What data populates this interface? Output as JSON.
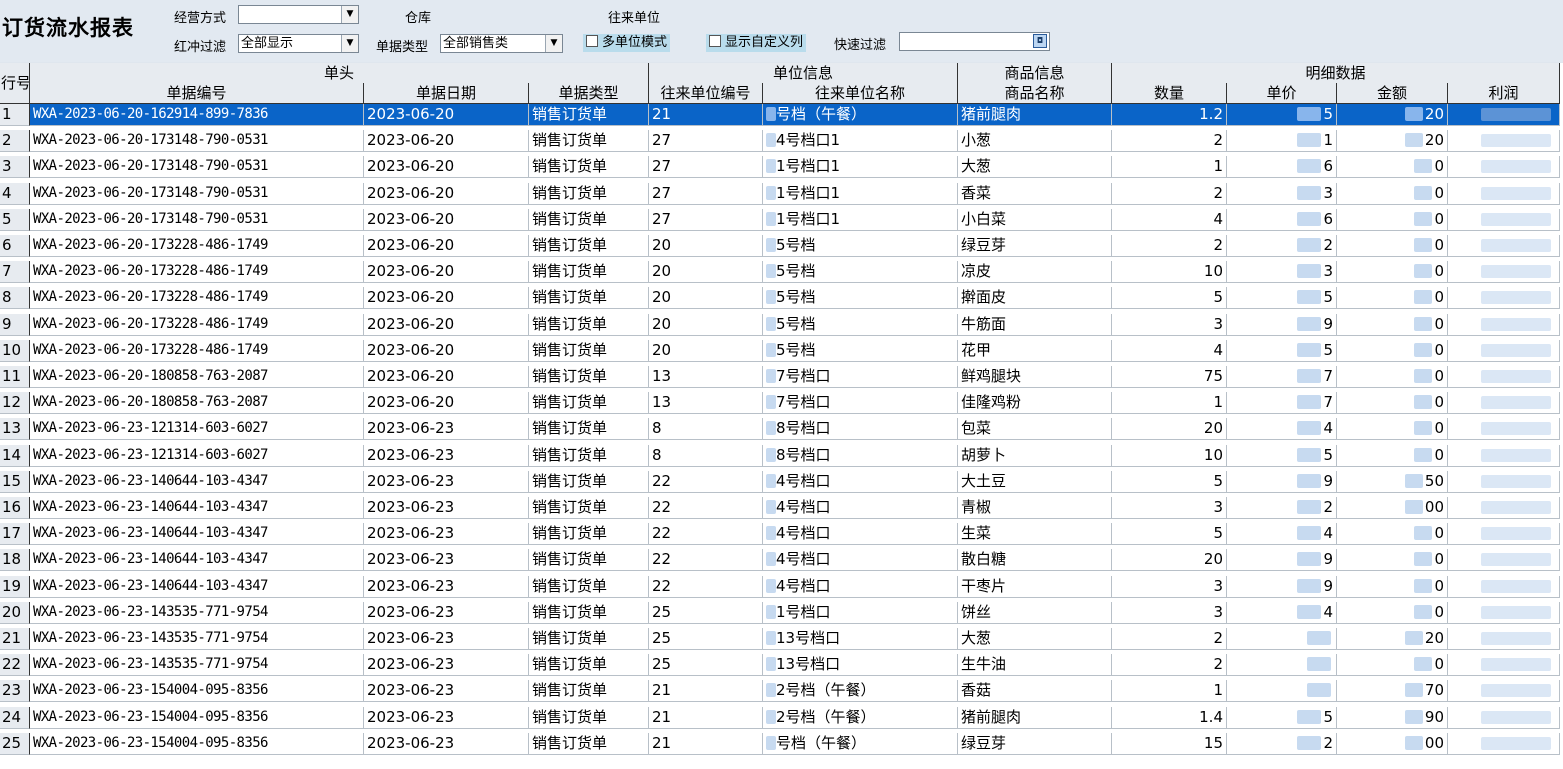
{
  "report_title": "订货流水报表",
  "filters": {
    "biz_mode_label": "经营方式",
    "biz_mode_value": "",
    "warehouse_label": "仓库",
    "partner_label": "往来单位",
    "redflush_label": "红冲过滤",
    "redflush_value": "全部显示",
    "doctype_label": "单据类型",
    "doctype_value": "全部销售类",
    "multi_unit_label": "多单位模式",
    "custom_cols_label": "显示自定义列",
    "quick_filter_label": "快速过滤",
    "quick_filter_value": ""
  },
  "grid": {
    "rownum_header": "行号",
    "groups": [
      "单头",
      "单位信息",
      "商品信息",
      "明细数据"
    ],
    "columns": [
      "单据编号",
      "单据日期",
      "单据类型",
      "往来单位编号",
      "往来单位名称",
      "商品名称",
      "数量",
      "单价",
      "金额",
      "利润"
    ],
    "rows": [
      {
        "n": "1",
        "doc": "WXA-2023-06-20-162914-899-7836",
        "date": "2023-06-20",
        "type": "销售订货单",
        "pid": "21",
        "pname": "号档（午餐）",
        "item": "猪前腿肉",
        "qty": "1.2",
        "price": "5",
        "amount": "20"
      },
      {
        "n": "2",
        "doc": "WXA-2023-06-20-173148-790-0531",
        "date": "2023-06-20",
        "type": "销售订货单",
        "pid": "27",
        "pname": "4号档口1",
        "item": "小葱",
        "qty": "2",
        "price": "1",
        "amount": "20"
      },
      {
        "n": "3",
        "doc": "WXA-2023-06-20-173148-790-0531",
        "date": "2023-06-20",
        "type": "销售订货单",
        "pid": "27",
        "pname": "1号档口1",
        "item": "大葱",
        "qty": "1",
        "price": "6",
        "amount": "0"
      },
      {
        "n": "4",
        "doc": "WXA-2023-06-20-173148-790-0531",
        "date": "2023-06-20",
        "type": "销售订货单",
        "pid": "27",
        "pname": "1号档口1",
        "item": "香菜",
        "qty": "2",
        "price": "3",
        "amount": "0"
      },
      {
        "n": "5",
        "doc": "WXA-2023-06-20-173148-790-0531",
        "date": "2023-06-20",
        "type": "销售订货单",
        "pid": "27",
        "pname": "1号档口1",
        "item": "小白菜",
        "qty": "4",
        "price": "6",
        "amount": "0"
      },
      {
        "n": "6",
        "doc": "WXA-2023-06-20-173228-486-1749",
        "date": "2023-06-20",
        "type": "销售订货单",
        "pid": "20",
        "pname": "5号档",
        "item": "绿豆芽",
        "qty": "2",
        "price": "2",
        "amount": "0"
      },
      {
        "n": "7",
        "doc": "WXA-2023-06-20-173228-486-1749",
        "date": "2023-06-20",
        "type": "销售订货单",
        "pid": "20",
        "pname": "5号档",
        "item": "凉皮",
        "qty": "10",
        "price": "3",
        "amount": "0"
      },
      {
        "n": "8",
        "doc": "WXA-2023-06-20-173228-486-1749",
        "date": "2023-06-20",
        "type": "销售订货单",
        "pid": "20",
        "pname": "5号档",
        "item": "擀面皮",
        "qty": "5",
        "price": "5",
        "amount": "0"
      },
      {
        "n": "9",
        "doc": "WXA-2023-06-20-173228-486-1749",
        "date": "2023-06-20",
        "type": "销售订货单",
        "pid": "20",
        "pname": "5号档",
        "item": "牛筋面",
        "qty": "3",
        "price": "9",
        "amount": "0"
      },
      {
        "n": "10",
        "doc": "WXA-2023-06-20-173228-486-1749",
        "date": "2023-06-20",
        "type": "销售订货单",
        "pid": "20",
        "pname": "5号档",
        "item": "花甲",
        "qty": "4",
        "price": "5",
        "amount": "0"
      },
      {
        "n": "11",
        "doc": "WXA-2023-06-20-180858-763-2087",
        "date": "2023-06-20",
        "type": "销售订货单",
        "pid": "13",
        "pname": "7号档口",
        "item": "鲜鸡腿块",
        "qty": "75",
        "price": "7",
        "amount": "0"
      },
      {
        "n": "12",
        "doc": "WXA-2023-06-20-180858-763-2087",
        "date": "2023-06-20",
        "type": "销售订货单",
        "pid": "13",
        "pname": "7号档口",
        "item": "佳隆鸡粉",
        "qty": "1",
        "price": "7",
        "amount": "0"
      },
      {
        "n": "13",
        "doc": "WXA-2023-06-23-121314-603-6027",
        "date": "2023-06-23",
        "type": "销售订货单",
        "pid": "8",
        "pname": "8号档口",
        "item": "包菜",
        "qty": "20",
        "price": "4",
        "amount": "0"
      },
      {
        "n": "14",
        "doc": "WXA-2023-06-23-121314-603-6027",
        "date": "2023-06-23",
        "type": "销售订货单",
        "pid": "8",
        "pname": "8号档口",
        "item": "胡萝卜",
        "qty": "10",
        "price": "5",
        "amount": "0"
      },
      {
        "n": "15",
        "doc": "WXA-2023-06-23-140644-103-4347",
        "date": "2023-06-23",
        "type": "销售订货单",
        "pid": "22",
        "pname": "4号档口",
        "item": "大土豆",
        "qty": "5",
        "price": "9",
        "amount": "50"
      },
      {
        "n": "16",
        "doc": "WXA-2023-06-23-140644-103-4347",
        "date": "2023-06-23",
        "type": "销售订货单",
        "pid": "22",
        "pname": "4号档口",
        "item": "青椒",
        "qty": "3",
        "price": "2",
        "amount": "00"
      },
      {
        "n": "17",
        "doc": "WXA-2023-06-23-140644-103-4347",
        "date": "2023-06-23",
        "type": "销售订货单",
        "pid": "22",
        "pname": "4号档口",
        "item": "生菜",
        "qty": "5",
        "price": "4",
        "amount": "0"
      },
      {
        "n": "18",
        "doc": "WXA-2023-06-23-140644-103-4347",
        "date": "2023-06-23",
        "type": "销售订货单",
        "pid": "22",
        "pname": "4号档口",
        "item": "散白糖",
        "qty": "20",
        "price": "9",
        "amount": "0"
      },
      {
        "n": "19",
        "doc": "WXA-2023-06-23-140644-103-4347",
        "date": "2023-06-23",
        "type": "销售订货单",
        "pid": "22",
        "pname": "4号档口",
        "item": "干枣片",
        "qty": "3",
        "price": "9",
        "amount": "0"
      },
      {
        "n": "20",
        "doc": "WXA-2023-06-23-143535-771-9754",
        "date": "2023-06-23",
        "type": "销售订货单",
        "pid": "25",
        "pname": "1号档口",
        "item": "饼丝",
        "qty": "3",
        "price": "4",
        "amount": "0"
      },
      {
        "n": "21",
        "doc": "WXA-2023-06-23-143535-771-9754",
        "date": "2023-06-23",
        "type": "销售订货单",
        "pid": "25",
        "pname": "13号档口",
        "item": "大葱",
        "qty": "2",
        "price": "",
        "amount": "20"
      },
      {
        "n": "22",
        "doc": "WXA-2023-06-23-143535-771-9754",
        "date": "2023-06-23",
        "type": "销售订货单",
        "pid": "25",
        "pname": "13号档口",
        "item": "生牛油",
        "qty": "2",
        "price": "",
        "amount": "0"
      },
      {
        "n": "23",
        "doc": "WXA-2023-06-23-154004-095-8356",
        "date": "2023-06-23",
        "type": "销售订货单",
        "pid": "21",
        "pname": "2号档（午餐）",
        "item": "香菇",
        "qty": "1",
        "price": "",
        "amount": "70"
      },
      {
        "n": "24",
        "doc": "WXA-2023-06-23-154004-095-8356",
        "date": "2023-06-23",
        "type": "销售订货单",
        "pid": "21",
        "pname": "2号档（午餐）",
        "item": "猪前腿肉",
        "qty": "1.4",
        "price": "5",
        "amount": "90"
      },
      {
        "n": "25",
        "doc": "WXA-2023-06-23-154004-095-8356",
        "date": "2023-06-23",
        "type": "销售订货单",
        "pid": "21",
        "pname": "号档（午餐）",
        "item": "绿豆芽",
        "qty": "15",
        "price": "2",
        "amount": "00"
      }
    ]
  }
}
